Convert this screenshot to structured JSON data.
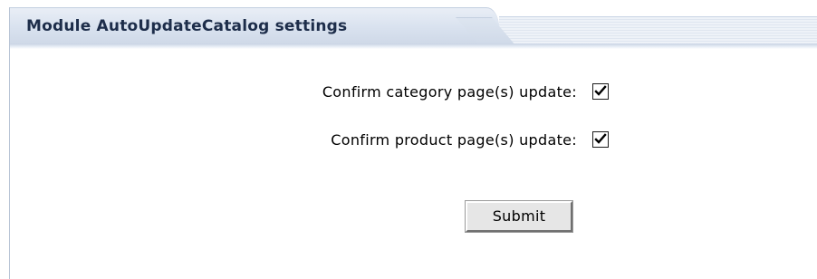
{
  "panel": {
    "title": "Module AutoUpdateCatalog settings"
  },
  "form": {
    "fields": [
      {
        "label": "Confirm category page(s) update:",
        "checked": true
      },
      {
        "label": "Confirm product page(s) update:",
        "checked": true
      }
    ],
    "submit_label": "Submit"
  },
  "colors": {
    "title_text": "#1d2d4a",
    "header_bg": "#d9e2ef",
    "border": "#b8c4d6"
  }
}
